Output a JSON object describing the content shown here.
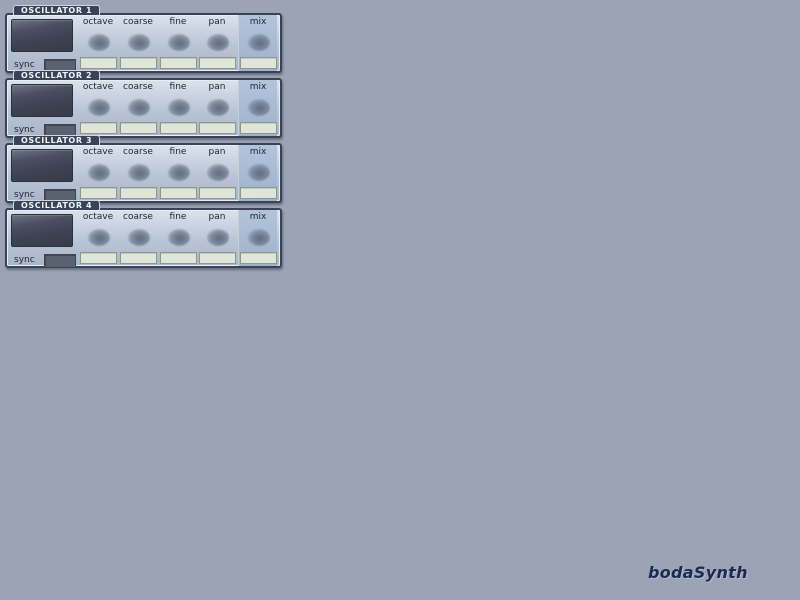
{
  "app": {
    "brand": "bodaSynth"
  },
  "oscillators": [
    {
      "title": "OSCILLATOR 1",
      "sync_label": "sync",
      "controls": [
        {
          "label": "octave"
        },
        {
          "label": "coarse"
        },
        {
          "label": "fine"
        },
        {
          "label": "pan"
        },
        {
          "label": "mix"
        }
      ]
    },
    {
      "title": "OSCILLATOR 2",
      "sync_label": "sync",
      "controls": [
        {
          "label": "octave"
        },
        {
          "label": "coarse"
        },
        {
          "label": "fine"
        },
        {
          "label": "pan"
        },
        {
          "label": "mix"
        }
      ]
    },
    {
      "title": "OSCILLATOR 3",
      "sync_label": "sync",
      "controls": [
        {
          "label": "octave"
        },
        {
          "label": "coarse"
        },
        {
          "label": "fine"
        },
        {
          "label": "pan"
        },
        {
          "label": "mix"
        }
      ]
    },
    {
      "title": "OSCILLATOR 4",
      "sync_label": "sync",
      "controls": [
        {
          "label": "octave"
        },
        {
          "label": "coarse"
        },
        {
          "label": "fine"
        },
        {
          "label": "pan"
        },
        {
          "label": "mix"
        }
      ]
    }
  ],
  "colors": {
    "background": "#9ba3b5",
    "panel_border": "#3a4258",
    "panel_light": "#dbe2ec",
    "display": "#3e4353",
    "value_field": "#dfe6d9",
    "brand": "#1c2a52"
  }
}
